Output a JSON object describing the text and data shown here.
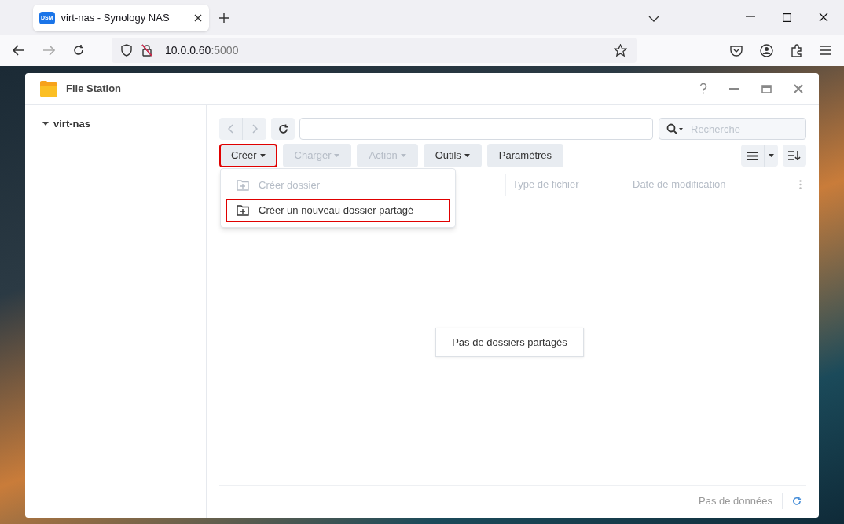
{
  "browser": {
    "tab": {
      "title": "virt-nas - Synology NAS",
      "favicon": "DSM"
    },
    "url": {
      "host": "10.0.0.60",
      "port": ":5000"
    }
  },
  "window": {
    "title": "File Station"
  },
  "sidebar": {
    "items": [
      {
        "label": "virt-nas",
        "expanded": true
      }
    ]
  },
  "toolbar": {
    "nav_back_disabled": true,
    "nav_forward_disabled": true,
    "search": {
      "placeholder": "Recherche"
    },
    "buttons": [
      {
        "label": "Créer",
        "disabled": false,
        "dropdown": true,
        "highlighted": true
      },
      {
        "label": "Charger",
        "disabled": true,
        "dropdown": true,
        "highlighted": false
      },
      {
        "label": "Action",
        "disabled": true,
        "dropdown": true,
        "highlighted": false
      },
      {
        "label": "Outils",
        "disabled": false,
        "dropdown": true,
        "highlighted": false
      },
      {
        "label": "Paramètres",
        "disabled": false,
        "dropdown": false,
        "highlighted": false
      }
    ]
  },
  "table": {
    "columns": [
      "Type de fichier",
      "Date de modification"
    ]
  },
  "menu": {
    "items": [
      {
        "label": "Créer dossier",
        "disabled": true,
        "highlighted": false
      },
      {
        "label": "Créer un nouveau dossier partagé",
        "disabled": false,
        "highlighted": true
      }
    ]
  },
  "empty_message": "Pas de dossiers partagés",
  "status_bar": {
    "text": "Pas de données"
  }
}
